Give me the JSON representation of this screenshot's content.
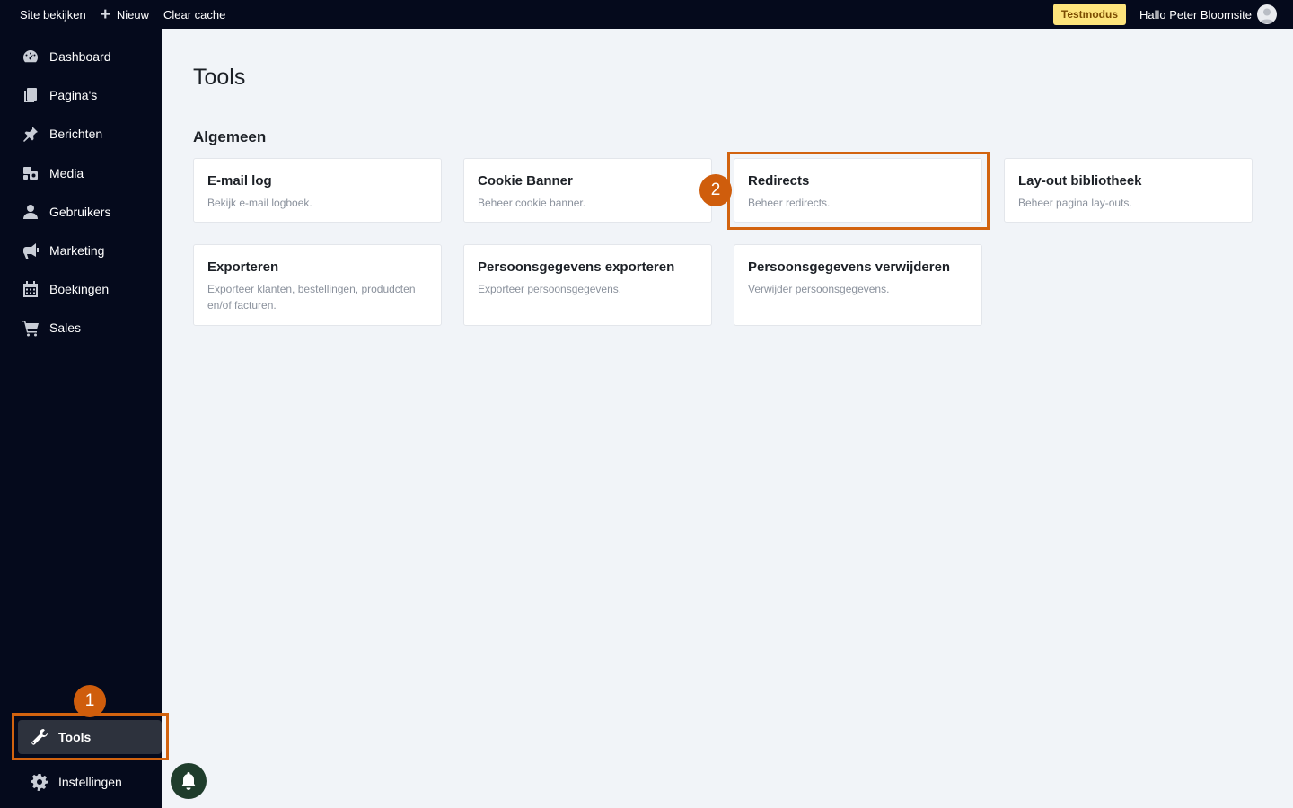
{
  "topbar": {
    "view_site": "Site bekijken",
    "new_label": "Nieuw",
    "clear_cache": "Clear cache",
    "test_mode": "Testmodus",
    "greeting": "Hallo Peter Bloomsite"
  },
  "sidebar": {
    "items": [
      {
        "label": "Dashboard",
        "icon": "dashboard-icon"
      },
      {
        "label": "Pagina's",
        "icon": "pages-icon"
      },
      {
        "label": "Berichten",
        "icon": "pin-icon"
      },
      {
        "label": "Media",
        "icon": "media-icon"
      },
      {
        "label": "Gebruikers",
        "icon": "user-icon"
      },
      {
        "label": "Marketing",
        "icon": "megaphone-icon"
      },
      {
        "label": "Boekingen",
        "icon": "calendar-icon"
      },
      {
        "label": "Sales",
        "icon": "cart-icon"
      }
    ],
    "tools": "Tools",
    "settings": "Instellingen"
  },
  "annotations": {
    "step1": "1",
    "step2": "2",
    "highlight_color": "#d2630f"
  },
  "main": {
    "title": "Tools",
    "section": "Algemeen",
    "cards": [
      {
        "title": "E-mail log",
        "desc": "Bekijk e-mail logboek."
      },
      {
        "title": "Cookie Banner",
        "desc": "Beheer cookie banner."
      },
      {
        "title": "Redirects",
        "desc": "Beheer redirects."
      },
      {
        "title": "Lay-out bibliotheek",
        "desc": "Beheer pagina lay-outs."
      },
      {
        "title": "Exporteren",
        "desc": "Exporteer klanten, bestellingen, produdcten en/of facturen."
      },
      {
        "title": "Persoonsgegevens exporteren",
        "desc": "Exporteer persoonsgegevens."
      },
      {
        "title": "Persoonsgegevens verwijderen",
        "desc": "Verwijder persoonsgegevens."
      }
    ]
  }
}
